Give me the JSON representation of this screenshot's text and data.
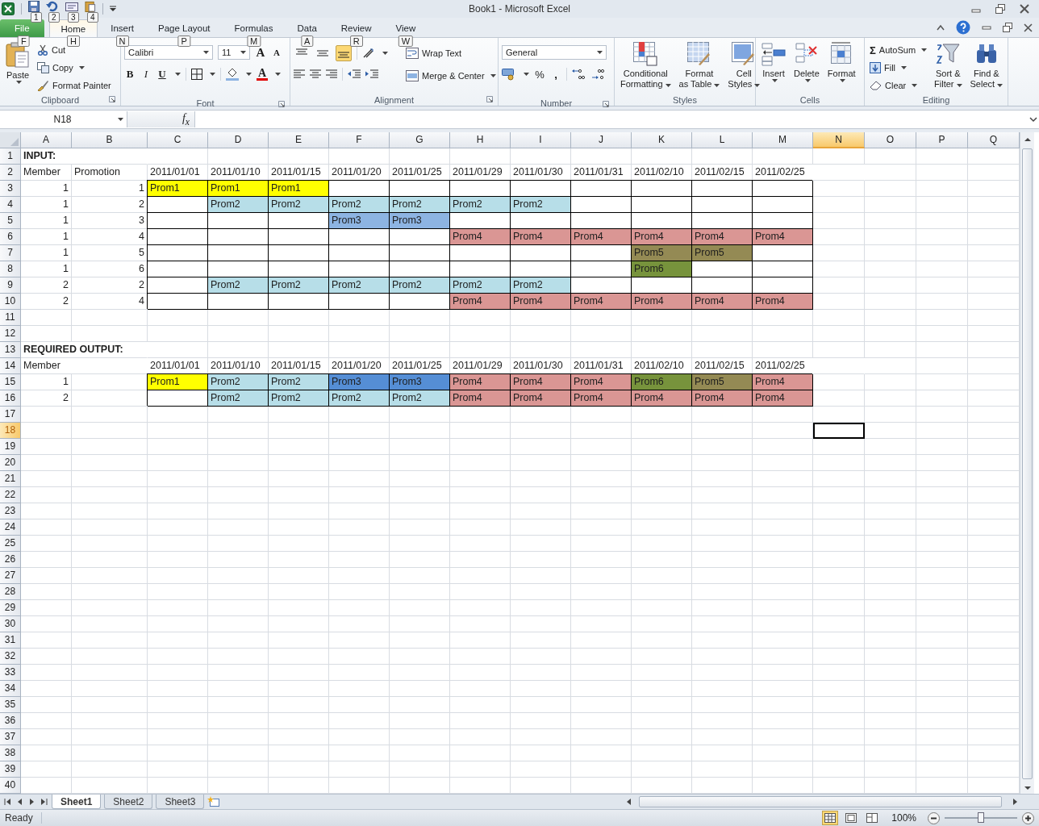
{
  "window": {
    "title": "Book1  -  Microsoft Excel"
  },
  "quick_access": {
    "key_tips": [
      "1",
      "2",
      "3",
      "4"
    ]
  },
  "tabs": [
    {
      "label": "File",
      "key_tip": "F",
      "selected": false,
      "kind": "file"
    },
    {
      "label": "Home",
      "key_tip": "H",
      "selected": true,
      "kind": "tab"
    },
    {
      "label": "Insert",
      "key_tip": "N",
      "selected": false,
      "kind": "tab"
    },
    {
      "label": "Page Layout",
      "key_tip": "P",
      "selected": false,
      "kind": "tab"
    },
    {
      "label": "Formulas",
      "key_tip": "M",
      "selected": false,
      "kind": "tab"
    },
    {
      "label": "Data",
      "key_tip": "A",
      "selected": false,
      "kind": "tab"
    },
    {
      "label": "Review",
      "key_tip": "R",
      "selected": false,
      "kind": "tab"
    },
    {
      "label": "View",
      "key_tip": "W",
      "selected": false,
      "kind": "tab"
    }
  ],
  "clipboard": {
    "label": "Clipboard",
    "paste": "Paste",
    "cut": "Cut",
    "copy": "Copy",
    "format_painter": "Format Painter"
  },
  "font": {
    "label": "Font",
    "name": "Calibri",
    "size": "11",
    "grow": "A",
    "shrink": "A",
    "bold": "B",
    "italic": "I",
    "underline": "U",
    "font_color_letter": "A"
  },
  "alignment": {
    "label": "Alignment",
    "wrap_text": "Wrap Text",
    "merge_center": "Merge & Center",
    "vertical": [
      {
        "selected": false
      },
      {
        "selected": false
      },
      {
        "selected": true
      }
    ]
  },
  "number": {
    "label": "Number",
    "format": "General",
    "percent": "%",
    "comma": ","
  },
  "styles": {
    "label": "Styles",
    "conditional": [
      "Conditional",
      "Formatting"
    ],
    "format_table": [
      "Format",
      "as Table"
    ],
    "cell_styles": [
      "Cell",
      "Styles"
    ]
  },
  "cells": {
    "label": "Cells",
    "insert": "Insert",
    "delete": "Delete",
    "format": "Format"
  },
  "editing": {
    "label": "Editing",
    "sigma": "Σ",
    "autosum": "AutoSum",
    "fill": "Fill",
    "clear": "Clear",
    "sort": [
      "Sort &",
      "Filter"
    ],
    "find": [
      "Find &",
      "Select"
    ]
  },
  "formula_bar": {
    "name_box": "N18",
    "fx": "f$_{x}$"
  },
  "sheet": {
    "columns": [
      {
        "label": "A",
        "selected": false
      },
      {
        "label": "B",
        "selected": false
      },
      {
        "label": "C",
        "selected": false
      },
      {
        "label": "D",
        "selected": false
      },
      {
        "label": "E",
        "selected": false
      },
      {
        "label": "F",
        "selected": false
      },
      {
        "label": "G",
        "selected": false
      },
      {
        "label": "H",
        "selected": false
      },
      {
        "label": "I",
        "selected": false
      },
      {
        "label": "J",
        "selected": false
      },
      {
        "label": "K",
        "selected": false
      },
      {
        "label": "L",
        "selected": false
      },
      {
        "label": "M",
        "selected": false
      },
      {
        "label": "N",
        "selected": true
      },
      {
        "label": "O",
        "selected": false
      },
      {
        "label": "P",
        "selected": false
      },
      {
        "label": "Q",
        "selected": false
      }
    ],
    "rows": [
      {
        "number": "1",
        "selected": false,
        "cells": [
          {
            "text": "INPUT:",
            "bold": true
          }
        ]
      },
      {
        "number": "2",
        "selected": false,
        "cells": [
          {
            "text": "Member"
          },
          {
            "text": "Promotion"
          },
          {
            "text": "2011/01/01"
          },
          {
            "text": "2011/01/10"
          },
          {
            "text": "2011/01/15"
          },
          {
            "text": "2011/01/20"
          },
          {
            "text": "2011/01/25"
          },
          {
            "text": "2011/01/29"
          },
          {
            "text": "2011/01/30"
          },
          {
            "text": "2011/01/31"
          },
          {
            "text": "2011/02/10"
          },
          {
            "text": "2011/02/15"
          },
          {
            "text": "2011/02/25"
          }
        ]
      },
      {
        "number": "3",
        "selected": false,
        "cells": [
          {
            "text": "1",
            "kind": "number"
          },
          {
            "text": "1",
            "kind": "number"
          },
          {
            "text": "Prom1",
            "color": "#ffff00",
            "boxed": true
          },
          {
            "text": "Prom1",
            "color": "#ffff00",
            "boxed": true
          },
          {
            "text": "Prom1",
            "color": "#ffff00",
            "boxed": true
          },
          {
            "boxed": true
          },
          {
            "boxed": true
          },
          {
            "boxed": true
          },
          {
            "boxed": true
          },
          {
            "boxed": true
          },
          {
            "boxed": true
          },
          {
            "boxed": true
          },
          {
            "boxed": true
          }
        ]
      },
      {
        "number": "4",
        "selected": false,
        "cells": [
          {
            "text": "1",
            "kind": "number"
          },
          {
            "text": "2",
            "kind": "number"
          },
          {
            "boxed": true
          },
          {
            "text": "Prom2",
            "color": "#b7dee8",
            "boxed": true
          },
          {
            "text": "Prom2",
            "color": "#b7dee8",
            "boxed": true
          },
          {
            "text": "Prom2",
            "color": "#b7dee8",
            "boxed": true
          },
          {
            "text": "Prom2",
            "color": "#b7dee8",
            "boxed": true
          },
          {
            "text": "Prom2",
            "color": "#b7dee8",
            "boxed": true
          },
          {
            "text": "Prom2",
            "color": "#b7dee8",
            "boxed": true
          },
          {
            "boxed": true
          },
          {
            "boxed": true
          },
          {
            "boxed": true
          },
          {
            "boxed": true
          }
        ]
      },
      {
        "number": "5",
        "selected": false,
        "cells": [
          {
            "text": "1",
            "kind": "number"
          },
          {
            "text": "3",
            "kind": "number"
          },
          {
            "boxed": true
          },
          {
            "boxed": true
          },
          {
            "boxed": true
          },
          {
            "text": "Prom3",
            "color": "#8db4e2",
            "boxed": true
          },
          {
            "text": "Prom3",
            "color": "#8db4e2",
            "boxed": true
          },
          {
            "boxed": true
          },
          {
            "boxed": true
          },
          {
            "boxed": true
          },
          {
            "boxed": true
          },
          {
            "boxed": true
          },
          {
            "boxed": true
          }
        ]
      },
      {
        "number": "6",
        "selected": false,
        "cells": [
          {
            "text": "1",
            "kind": "number"
          },
          {
            "text": "4",
            "kind": "number"
          },
          {
            "boxed": true
          },
          {
            "boxed": true
          },
          {
            "boxed": true
          },
          {
            "boxed": true
          },
          {
            "boxed": true
          },
          {
            "text": "Prom4",
            "color": "#da9694",
            "boxed": true
          },
          {
            "text": "Prom4",
            "color": "#da9694",
            "boxed": true
          },
          {
            "text": "Prom4",
            "color": "#da9694",
            "boxed": true
          },
          {
            "text": "Prom4",
            "color": "#da9694",
            "boxed": true
          },
          {
            "text": "Prom4",
            "color": "#da9694",
            "boxed": true
          },
          {
            "text": "Prom4",
            "color": "#da9694",
            "boxed": true
          }
        ]
      },
      {
        "number": "7",
        "selected": false,
        "cells": [
          {
            "text": "1",
            "kind": "number"
          },
          {
            "text": "5",
            "kind": "number"
          },
          {
            "boxed": true
          },
          {
            "boxed": true
          },
          {
            "boxed": true
          },
          {
            "boxed": true
          },
          {
            "boxed": true
          },
          {
            "boxed": true
          },
          {
            "boxed": true
          },
          {
            "boxed": true
          },
          {
            "text": "Prom5",
            "color": "#948a54",
            "boxed": true
          },
          {
            "text": "Prom5",
            "color": "#948a54",
            "boxed": true
          },
          {
            "boxed": true
          }
        ]
      },
      {
        "number": "8",
        "selected": false,
        "cells": [
          {
            "text": "1",
            "kind": "number"
          },
          {
            "text": "6",
            "kind": "number"
          },
          {
            "boxed": true
          },
          {
            "boxed": true
          },
          {
            "boxed": true
          },
          {
            "boxed": true
          },
          {
            "boxed": true
          },
          {
            "boxed": true
          },
          {
            "boxed": true
          },
          {
            "boxed": true
          },
          {
            "text": "Prom6",
            "color": "#77933c",
            "boxed": true
          },
          {
            "boxed": true
          },
          {
            "boxed": true
          }
        ]
      },
      {
        "number": "9",
        "selected": false,
        "cells": [
          {
            "text": "2",
            "kind": "number"
          },
          {
            "text": "2",
            "kind": "number"
          },
          {
            "boxed": true
          },
          {
            "text": "Prom2",
            "color": "#b7dee8",
            "boxed": true
          },
          {
            "text": "Prom2",
            "color": "#b7dee8",
            "boxed": true
          },
          {
            "text": "Prom2",
            "color": "#b7dee8",
            "boxed": true
          },
          {
            "text": "Prom2",
            "color": "#b7dee8",
            "boxed": true
          },
          {
            "text": "Prom2",
            "color": "#b7dee8",
            "boxed": true
          },
          {
            "text": "Prom2",
            "color": "#b7dee8",
            "boxed": true
          },
          {
            "boxed": true
          },
          {
            "boxed": true
          },
          {
            "boxed": true
          },
          {
            "boxed": true
          }
        ]
      },
      {
        "number": "10",
        "selected": false,
        "cells": [
          {
            "text": "2",
            "kind": "number"
          },
          {
            "text": "4",
            "kind": "number"
          },
          {
            "boxed": true
          },
          {
            "boxed": true
          },
          {
            "boxed": true
          },
          {
            "boxed": true
          },
          {
            "boxed": true
          },
          {
            "text": "Prom4",
            "color": "#da9694",
            "boxed": true
          },
          {
            "text": "Prom4",
            "color": "#da9694",
            "boxed": true
          },
          {
            "text": "Prom4",
            "color": "#da9694",
            "boxed": true
          },
          {
            "text": "Prom4",
            "color": "#da9694",
            "boxed": true
          },
          {
            "text": "Prom4",
            "color": "#da9694",
            "boxed": true
          },
          {
            "text": "Prom4",
            "color": "#da9694",
            "boxed": true
          }
        ]
      },
      {
        "number": "11",
        "selected": false
      },
      {
        "number": "12",
        "selected": false
      },
      {
        "number": "13",
        "selected": false,
        "cells": [
          {
            "text": "REQUIRED OUTPUT:",
            "bold": true
          }
        ]
      },
      {
        "number": "14",
        "selected": false,
        "cells": [
          {
            "text": "Member"
          },
          {},
          {
            "text": "2011/01/01"
          },
          {
            "text": "2011/01/10"
          },
          {
            "text": "2011/01/15"
          },
          {
            "text": "2011/01/20"
          },
          {
            "text": "2011/01/25"
          },
          {
            "text": "2011/01/29"
          },
          {
            "text": "2011/01/30"
          },
          {
            "text": "2011/01/31"
          },
          {
            "text": "2011/02/10"
          },
          {
            "text": "2011/02/15"
          },
          {
            "text": "2011/02/25"
          }
        ]
      },
      {
        "number": "15",
        "selected": false,
        "cells": [
          {
            "text": "1",
            "kind": "number"
          },
          {},
          {
            "text": "Prom1",
            "color": "#ffff00",
            "boxed": true
          },
          {
            "text": "Prom2",
            "color": "#b7dee8",
            "boxed": true
          },
          {
            "text": "Prom2",
            "color": "#b7dee8",
            "boxed": true
          },
          {
            "text": "Prom3",
            "color": "#558ed5",
            "boxed": true
          },
          {
            "text": "Prom3",
            "color": "#558ed5",
            "boxed": true
          },
          {
            "text": "Prom4",
            "color": "#da9694",
            "boxed": true
          },
          {
            "text": "Prom4",
            "color": "#da9694",
            "boxed": true
          },
          {
            "text": "Prom4",
            "color": "#da9694",
            "boxed": true
          },
          {
            "text": "Prom6",
            "color": "#77933c",
            "boxed": true
          },
          {
            "text": "Prom5",
            "color": "#948a54",
            "boxed": true
          },
          {
            "text": "Prom4",
            "color": "#da9694",
            "boxed": true
          }
        ]
      },
      {
        "number": "16",
        "selected": false,
        "cells": [
          {
            "text": "2",
            "kind": "number"
          },
          {},
          {
            "boxed": true
          },
          {
            "text": "Prom2",
            "color": "#b7dee8",
            "boxed": true
          },
          {
            "text": "Prom2",
            "color": "#b7dee8",
            "boxed": true
          },
          {
            "text": "Prom2",
            "color": "#b7dee8",
            "boxed": true
          },
          {
            "text": "Prom2",
            "color": "#b7dee8",
            "boxed": true
          },
          {
            "text": "Prom4",
            "color": "#da9694",
            "boxed": true
          },
          {
            "text": "Prom4",
            "color": "#da9694",
            "boxed": true
          },
          {
            "text": "Prom4",
            "color": "#da9694",
            "boxed": true
          },
          {
            "text": "Prom4",
            "color": "#da9694",
            "boxed": true
          },
          {
            "text": "Prom4",
            "color": "#da9694",
            "boxed": true
          },
          {
            "text": "Prom4",
            "color": "#da9694",
            "boxed": true
          }
        ]
      },
      {
        "number": "17",
        "selected": false
      },
      {
        "number": "18",
        "selected": true
      },
      {
        "number": "19",
        "selected": false
      },
      {
        "number": "20",
        "selected": false
      },
      {
        "number": "21",
        "selected": false
      },
      {
        "number": "22",
        "selected": false
      },
      {
        "number": "23",
        "selected": false
      },
      {
        "number": "24",
        "selected": false
      },
      {
        "number": "25",
        "selected": false
      },
      {
        "number": "26",
        "selected": false
      },
      {
        "number": "27",
        "selected": false
      },
      {
        "number": "28",
        "selected": false
      },
      {
        "number": "29",
        "selected": false
      },
      {
        "number": "30",
        "selected": false
      },
      {
        "number": "31",
        "selected": false
      },
      {
        "number": "32",
        "selected": false
      },
      {
        "number": "33",
        "selected": false
      },
      {
        "number": "34",
        "selected": false
      },
      {
        "number": "35",
        "selected": false
      },
      {
        "number": "36",
        "selected": false
      },
      {
        "number": "37",
        "selected": false
      },
      {
        "number": "38",
        "selected": false
      },
      {
        "number": "39",
        "selected": false
      },
      {
        "number": "40",
        "selected": false
      }
    ]
  },
  "sheet_tabs": [
    {
      "label": "Sheet1",
      "selected": true
    },
    {
      "label": "Sheet2",
      "selected": false
    },
    {
      "label": "Sheet3",
      "selected": false
    }
  ],
  "status_bar": {
    "text": "Ready",
    "views": [
      {
        "selected": true
      },
      {
        "selected": false
      },
      {
        "selected": false
      }
    ],
    "zoom": "100%",
    "zoom_slider": {
      "level": 0.5
    }
  }
}
